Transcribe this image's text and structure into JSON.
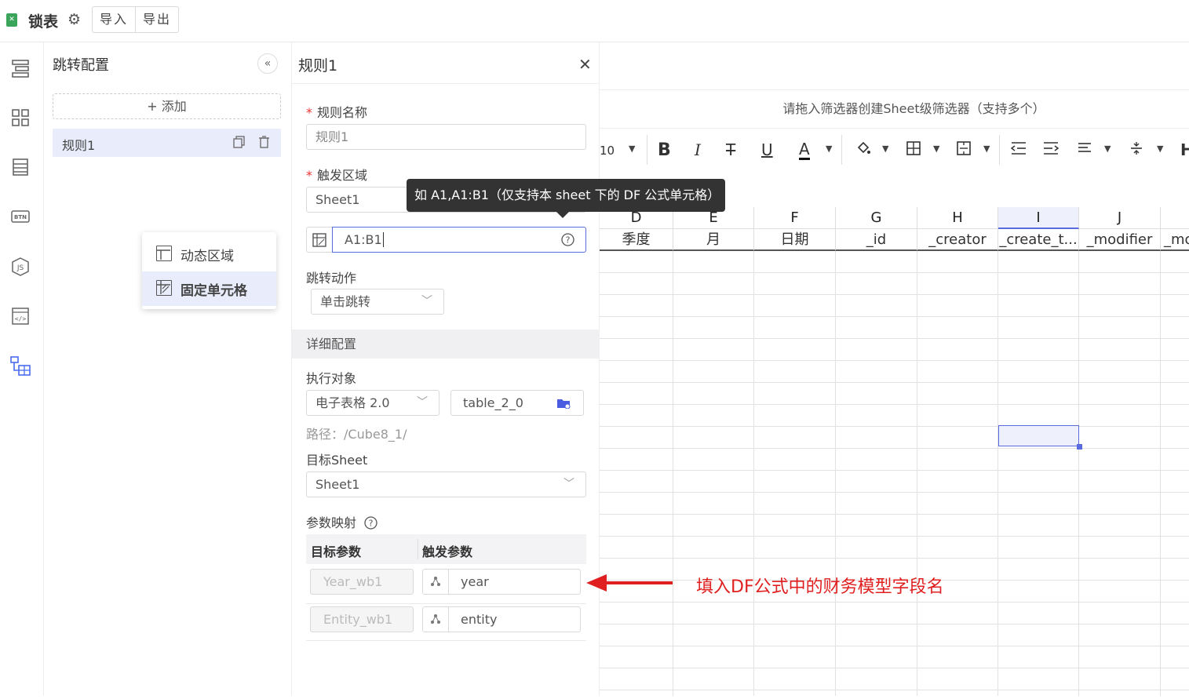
{
  "topbar": {
    "title": "锁表",
    "import_label": "导入",
    "export_label": "导出"
  },
  "left_rail": {
    "icons": [
      "layers-icon",
      "grid-icon",
      "list-icon",
      "btn-icon",
      "js-icon",
      "code-icon",
      "table-link-icon"
    ]
  },
  "jump_panel": {
    "title": "跳转配置",
    "add_label": "+ 添加",
    "rules": [
      {
        "label": "规则1"
      }
    ],
    "popup_menu": [
      {
        "label": "动态区域",
        "selected": false
      },
      {
        "label": "固定单元格",
        "selected": true
      }
    ]
  },
  "rule_panel": {
    "title": "规则1",
    "rule_name_label": "规则名称",
    "rule_name_value": "规则1",
    "trigger_area_label": "触发区域",
    "trigger_sheet_value": "Sheet1",
    "trigger_range_value": "A1:B1",
    "tooltip": "如 A1,A1:B1（仅支持本 sheet 下的 DF 公式单元格）",
    "jump_action_label": "跳转动作",
    "jump_action_value": "单击跳转",
    "detail_section": "详细配置",
    "exec_target_label": "执行对象",
    "exec_target_type": "电子表格 2.0",
    "exec_target_name": "table_2_0",
    "path_text": "路径：/Cube8_1/",
    "target_sheet_label": "目标Sheet",
    "target_sheet_value": "Sheet1",
    "param_map_label": "参数映射",
    "table_headers": [
      "目标参数",
      "触发参数"
    ],
    "params": [
      {
        "target": "Year_wb1",
        "trigger": "year"
      },
      {
        "target": "Entity_wb1",
        "trigger": "entity"
      }
    ]
  },
  "sheet": {
    "filter_hint": "请拖入筛选器创建Sheet级筛选器（支持多个）",
    "font_size": "10",
    "columns": [
      {
        "letter": "D",
        "field": "季度"
      },
      {
        "letter": "E",
        "field": "月"
      },
      {
        "letter": "F",
        "field": "日期"
      },
      {
        "letter": "G",
        "field": "_id"
      },
      {
        "letter": "H",
        "field": "_creator"
      },
      {
        "letter": "I",
        "field": "_create_t..."
      },
      {
        "letter": "J",
        "field": "_modifier"
      },
      {
        "letter": "",
        "field": "_mo"
      }
    ],
    "colors": {
      "selection": "#5a6be0",
      "annotation": "#e02020"
    }
  },
  "annotation": "填入DF公式中的财务模型字段名"
}
